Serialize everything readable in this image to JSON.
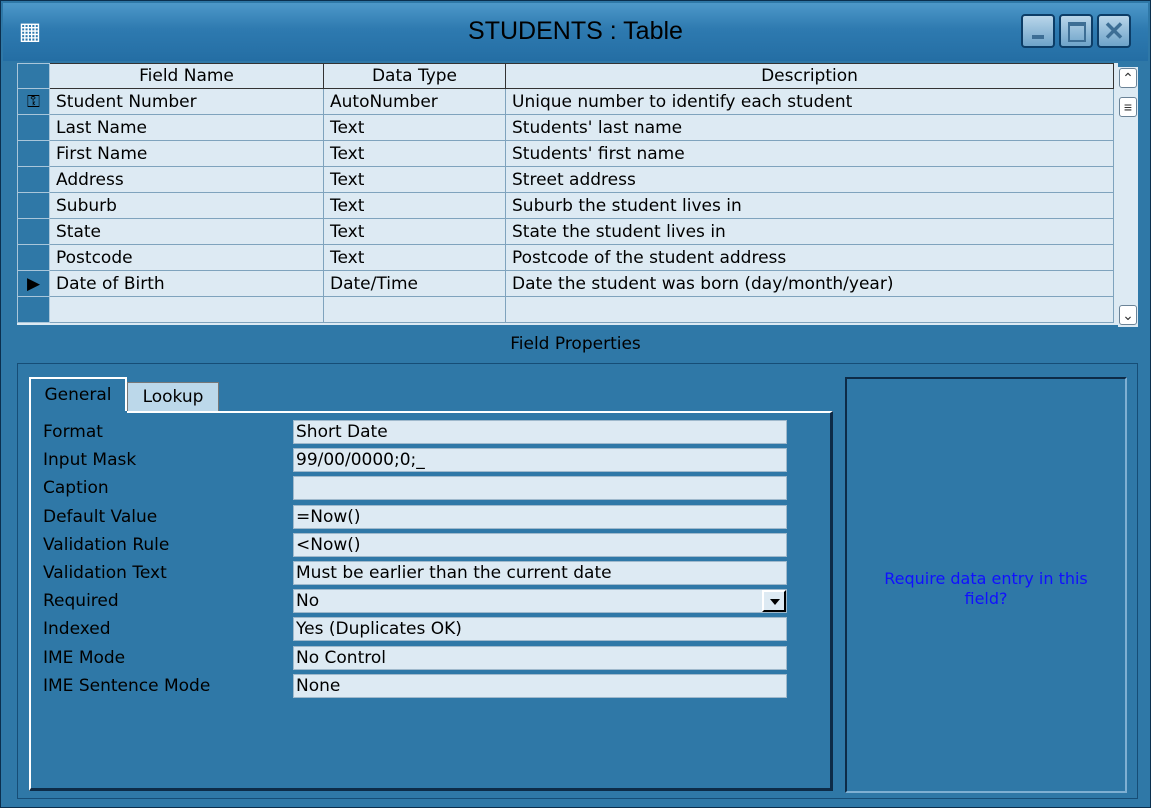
{
  "window": {
    "title": "STUDENTS : Table",
    "icon": "table-icon",
    "close_glyph": "✕"
  },
  "grid": {
    "headers": [
      "Field Name",
      "Data Type",
      "Description"
    ],
    "rows": [
      {
        "field": "Student Number",
        "type": "AutoNumber",
        "desc": "Unique number to identify each student",
        "selector": "key-icon"
      },
      {
        "field": "Last Name",
        "type": "Text",
        "desc": "Students' last name",
        "selector": ""
      },
      {
        "field": "First Name",
        "type": "Text",
        "desc": "Students' first name",
        "selector": ""
      },
      {
        "field": "Address",
        "type": "Text",
        "desc": "Street address",
        "selector": ""
      },
      {
        "field": "Suburb",
        "type": "Text",
        "desc": "Suburb the student lives in",
        "selector": ""
      },
      {
        "field": "State",
        "type": "Text",
        "desc": "State the student lives in",
        "selector": ""
      },
      {
        "field": "Postcode",
        "type": "Text",
        "desc": "Postcode of the student address",
        "selector": ""
      },
      {
        "field": "Date of Birth",
        "type": "Date/Time",
        "desc": "Date the student was born (day/month/year)",
        "selector": "current-row-arrow-icon"
      },
      {
        "field": "",
        "type": "",
        "desc": "",
        "selector": ""
      }
    ],
    "key_glyph": "⚿",
    "current_glyph": "▶",
    "scroll_up_glyph": "⌃",
    "scroll_thumb_glyph": "≡",
    "scroll_down_glyph": "⌄"
  },
  "field_properties": {
    "label": "Field Properties",
    "tabs": [
      {
        "label": "General",
        "active": true
      },
      {
        "label": "Lookup",
        "active": false
      }
    ],
    "properties": [
      {
        "name": "Format",
        "value": "Short Date"
      },
      {
        "name": "Input Mask",
        "value": "99/00/0000;0;_"
      },
      {
        "name": "Caption",
        "value": ""
      },
      {
        "name": "Default Value",
        "value": "=Now()"
      },
      {
        "name": "Validation Rule",
        "value": "<Now()"
      },
      {
        "name": "Validation Text",
        "value": "Must be earlier than the current date"
      },
      {
        "name": "Required",
        "value": "No"
      },
      {
        "name": "Indexed",
        "value": "Yes (Duplicates OK)"
      },
      {
        "name": "IME Mode",
        "value": "No Control"
      },
      {
        "name": "IME Sentence Mode",
        "value": "None"
      }
    ],
    "help_text": "Require data entry in this field?"
  },
  "colors": {
    "window_bg": "#2f78a7",
    "grid_bg": "#ddeaf3",
    "help_text": "#1010ff"
  }
}
